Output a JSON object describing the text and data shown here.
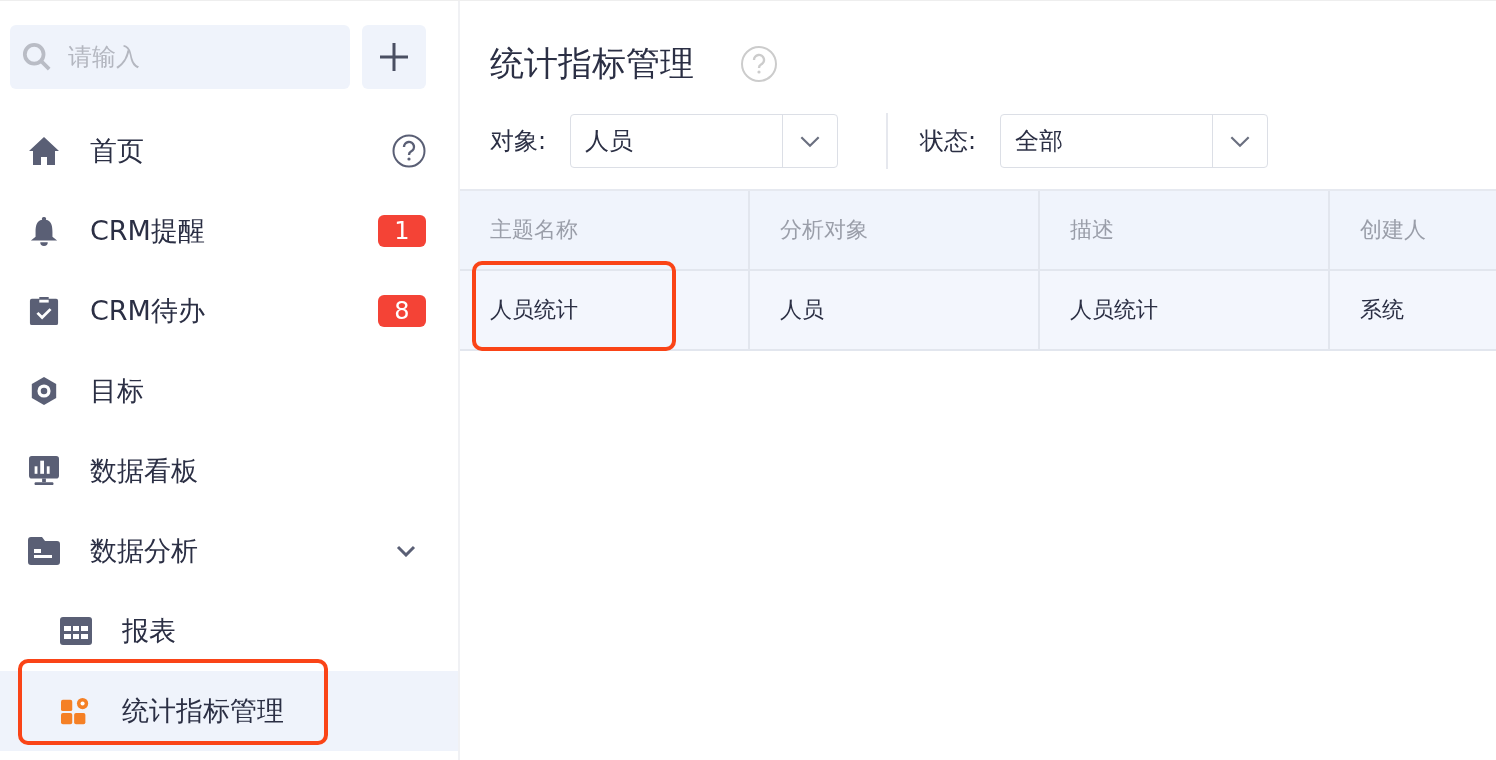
{
  "sidebar": {
    "search": {
      "placeholder": "请输入"
    },
    "items": [
      {
        "kind": "home",
        "label": "首页",
        "selected": false
      },
      {
        "kind": "bell",
        "label": "CRM提醒",
        "badge": "1",
        "selected": false
      },
      {
        "kind": "todo",
        "label": "CRM待办",
        "badge": "8",
        "selected": false
      },
      {
        "kind": "target",
        "label": "目标",
        "selected": false
      },
      {
        "kind": "board",
        "label": "数据看板",
        "selected": false
      },
      {
        "kind": "folder",
        "label": "数据分析",
        "expanded": true,
        "selected": false,
        "children": [
          {
            "kind": "table",
            "label": "报表",
            "selected": false,
            "highlighted": false
          },
          {
            "kind": "apps",
            "label": "统计指标管理",
            "selected": true,
            "highlighted": true
          }
        ]
      }
    ]
  },
  "page": {
    "title": "统计指标管理",
    "filters": [
      {
        "label": "对象:",
        "value": "人员"
      },
      {
        "label": "状态:",
        "value": "全部"
      }
    ],
    "table": {
      "columns": [
        "主题名称",
        "分析对象",
        "描述",
        "创建人"
      ],
      "rows": [
        {
          "cells": [
            {
              "text": "人员统计",
              "highlighted": true
            },
            {
              "text": "人员",
              "highlighted": false
            },
            {
              "text": "人员统计",
              "highlighted": false
            },
            {
              "text": "系统",
              "highlighted": false
            }
          ]
        }
      ]
    }
  }
}
